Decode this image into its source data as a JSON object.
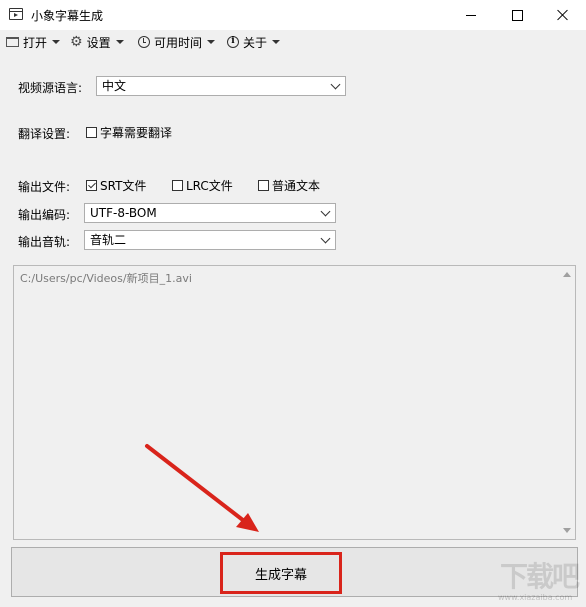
{
  "window": {
    "title": "小象字幕生成"
  },
  "menu": {
    "open": "打开",
    "settings": "设置",
    "time": "可用时间",
    "about": "关于"
  },
  "form": {
    "source_lang_label": "视频源语言:",
    "source_lang_value": "中文",
    "translate_label": "翻译设置:",
    "translate_checkbox": "字幕需要翻译",
    "translate_checked": false,
    "output_file_label": "输出文件:",
    "output_options": [
      {
        "label": "SRT文件",
        "checked": true
      },
      {
        "label": "LRC文件",
        "checked": false
      },
      {
        "label": "普通文本",
        "checked": false
      }
    ],
    "encoding_label": "输出编码:",
    "encoding_value": "UTF-8-BOM",
    "audio_label": "输出音轨:",
    "audio_value": "音轨二"
  },
  "file_list": {
    "items": [
      "C:/Users/pc/Videos/新项目_1.avi"
    ]
  },
  "actions": {
    "generate": "生成字幕"
  },
  "watermark": {
    "text": "下载吧",
    "url": "www.xiazaiba.com"
  },
  "colors": {
    "highlight": "#d9241b",
    "window_bg": "#f0f0f0"
  }
}
